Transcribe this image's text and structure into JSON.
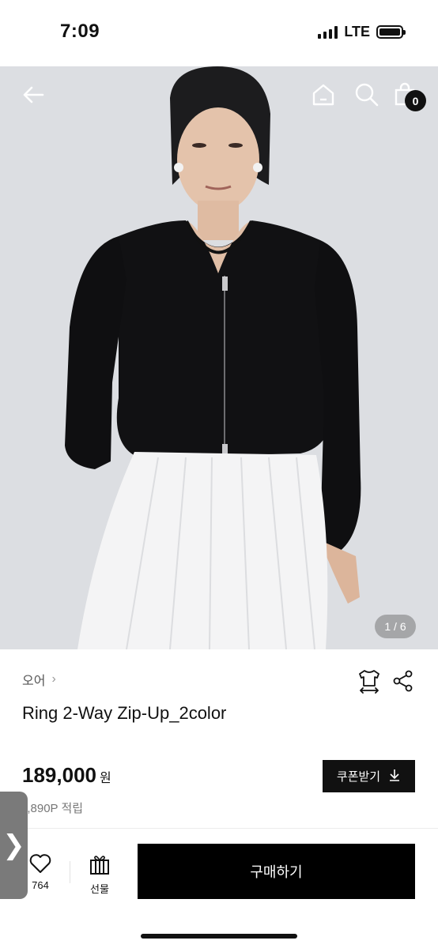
{
  "status_bar": {
    "time": "7:09",
    "network": "LTE"
  },
  "header": {
    "icons": [
      "back-arrow-icon",
      "home-icon",
      "search-icon",
      "cart-icon"
    ],
    "cart_count": "0"
  },
  "gallery": {
    "page_indicator": "1 / 6",
    "current": 1,
    "total": 6
  },
  "product": {
    "brand": "오어",
    "title": "Ring 2-Way Zip-Up_2color",
    "price": "189,000",
    "price_unit": "원",
    "coupon_label": "쿠폰받기",
    "points_text": "1,890P 적립"
  },
  "actions": {
    "like_count": "764",
    "gift_label": "선물",
    "buy_label": "구매하기"
  },
  "side_tab": {
    "glyph": "❯"
  },
  "colors": {
    "accent": "#000000",
    "text": "#111111",
    "muted": "#777777"
  }
}
